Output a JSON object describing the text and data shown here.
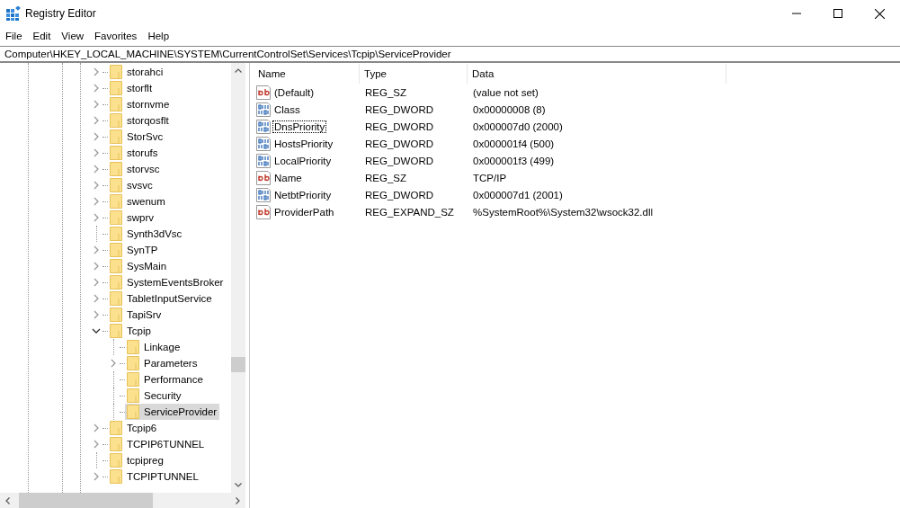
{
  "window": {
    "title": "Registry Editor"
  },
  "menu": [
    "File",
    "Edit",
    "View",
    "Favorites",
    "Help"
  ],
  "address": "Computer\\HKEY_LOCAL_MACHINE\\SYSTEM\\CurrentControlSet\\Services\\Tcpip\\ServiceProvider",
  "tree": [
    {
      "label": "storahci",
      "expandable": true,
      "expanded": false,
      "selected": false
    },
    {
      "label": "storflt",
      "expandable": true,
      "expanded": false,
      "selected": false
    },
    {
      "label": "stornvme",
      "expandable": true,
      "expanded": false,
      "selected": false
    },
    {
      "label": "storqosflt",
      "expandable": true,
      "expanded": false,
      "selected": false
    },
    {
      "label": "StorSvc",
      "expandable": true,
      "expanded": false,
      "selected": false
    },
    {
      "label": "storufs",
      "expandable": true,
      "expanded": false,
      "selected": false
    },
    {
      "label": "storvsc",
      "expandable": true,
      "expanded": false,
      "selected": false
    },
    {
      "label": "svsvc",
      "expandable": true,
      "expanded": false,
      "selected": false
    },
    {
      "label": "swenum",
      "expandable": true,
      "expanded": false,
      "selected": false
    },
    {
      "label": "swprv",
      "expandable": true,
      "expanded": false,
      "selected": false
    },
    {
      "label": "Synth3dVsc",
      "expandable": false,
      "selected": false
    },
    {
      "label": "SynTP",
      "expandable": true,
      "expanded": false,
      "selected": false
    },
    {
      "label": "SysMain",
      "expandable": true,
      "expanded": false,
      "selected": false
    },
    {
      "label": "SystemEventsBroker",
      "expandable": true,
      "expanded": false,
      "selected": false
    },
    {
      "label": "TabletInputService",
      "expandable": true,
      "expanded": false,
      "selected": false
    },
    {
      "label": "TapiSrv",
      "expandable": true,
      "expanded": false,
      "selected": false
    },
    {
      "label": "Tcpip",
      "expandable": true,
      "expanded": true,
      "selected": false,
      "children": [
        {
          "label": "Linkage",
          "expandable": false,
          "selected": false
        },
        {
          "label": "Parameters",
          "expandable": true,
          "expanded": false,
          "selected": false
        },
        {
          "label": "Performance",
          "expandable": false,
          "selected": false
        },
        {
          "label": "Security",
          "expandable": false,
          "selected": false
        },
        {
          "label": "ServiceProvider",
          "expandable": false,
          "selected": true
        }
      ]
    },
    {
      "label": "Tcpip6",
      "expandable": true,
      "expanded": false,
      "selected": false
    },
    {
      "label": "TCPIP6TUNNEL",
      "expandable": true,
      "expanded": false,
      "selected": false
    },
    {
      "label": "tcpipreg",
      "expandable": false,
      "selected": false
    },
    {
      "label": "TCPIPTUNNEL",
      "expandable": true,
      "expanded": false,
      "selected": false
    }
  ],
  "columns": [
    "Name",
    "Type",
    "Data"
  ],
  "values": [
    {
      "kind": "string",
      "name": "(Default)",
      "type": "REG_SZ",
      "data": "(value not set)",
      "focused": false
    },
    {
      "kind": "binary",
      "name": "Class",
      "type": "REG_DWORD",
      "data": "0x00000008 (8)",
      "focused": false
    },
    {
      "kind": "binary",
      "name": "DnsPriority",
      "type": "REG_DWORD",
      "data": "0x000007d0 (2000)",
      "focused": true
    },
    {
      "kind": "binary",
      "name": "HostsPriority",
      "type": "REG_DWORD",
      "data": "0x000001f4 (500)",
      "focused": false
    },
    {
      "kind": "binary",
      "name": "LocalPriority",
      "type": "REG_DWORD",
      "data": "0x000001f3 (499)",
      "focused": false
    },
    {
      "kind": "string",
      "name": "Name",
      "type": "REG_SZ",
      "data": "TCP/IP",
      "focused": false
    },
    {
      "kind": "binary",
      "name": "NetbtPriority",
      "type": "REG_DWORD",
      "data": "0x000007d1 (2001)",
      "focused": false
    },
    {
      "kind": "string",
      "name": "ProviderPath",
      "type": "REG_EXPAND_SZ",
      "data": "%SystemRoot%\\System32\\wsock32.dll",
      "focused": false
    }
  ]
}
